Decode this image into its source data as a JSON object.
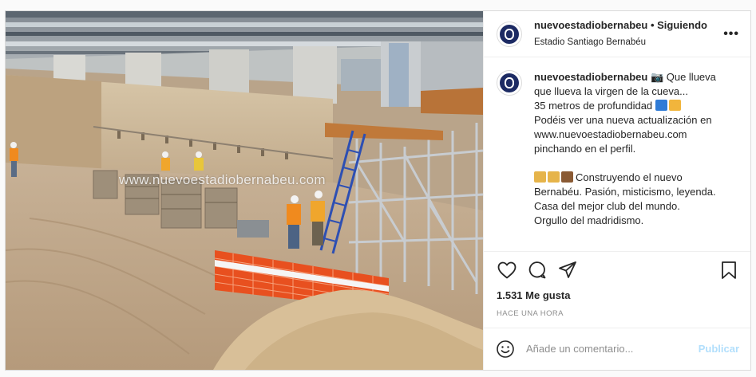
{
  "header": {
    "username": "nuevoestadiobernabeu",
    "separator": "•",
    "follow_status": "Siguiendo",
    "location": "Estadio Santiago Bernabéu",
    "more_glyph": "•••"
  },
  "photo": {
    "watermark": "www.nuevoestadiobernabeu.com",
    "description": "construction-site-photo"
  },
  "caption": {
    "username": "nuevoestadiobernabeu",
    "line1_rest": "📷 Que llueva",
    "line2": "que llueva la virgen de la cueva...",
    "line3": "35 metros de profundidad",
    "line4": "Podéis ver una nueva actualización en",
    "line5": "www.nuevoestadiobernabeu.com",
    "line6": "pinchando en el perfil.",
    "line7": "Construyendo el nuevo",
    "line8": "Bernabéu. Pasión, misticismo, leyenda.",
    "line9": "Casa del mejor club del mundo.",
    "line10": "Orgullo del madridismo."
  },
  "actions": {
    "icons": [
      "heart-icon",
      "comment-icon",
      "share-icon",
      "bookmark-icon"
    ]
  },
  "likes": {
    "text": "1.531 Me gusta"
  },
  "timestamp": {
    "text": "HACE UNA HORA"
  },
  "comment": {
    "placeholder": "Añade un comentario...",
    "publish_label": "Publicar"
  },
  "colors": {
    "accent": "#0095f6",
    "publish_disabled": "#b2dffc",
    "avatar_blue": "#1c2a63",
    "border": "#dbdbdb",
    "muted": "#8e8e8e"
  }
}
